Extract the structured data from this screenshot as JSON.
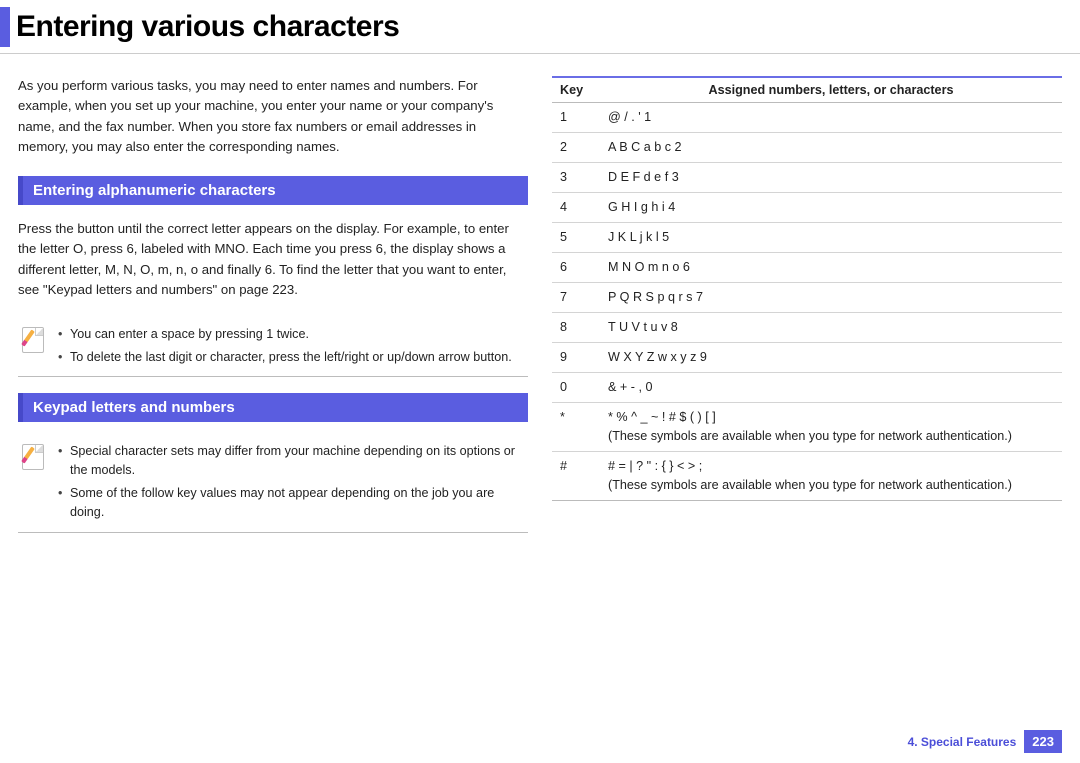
{
  "title": "Entering various characters",
  "intro": "As you perform various tasks, you may need to enter names and numbers. For example, when you set up your machine, you enter your name or your company's name, and the fax number. When you store fax numbers or email addresses in memory, you may also enter the corresponding names.",
  "section1": {
    "heading": "Entering alphanumeric characters",
    "body": "Press the button until the correct letter appears on the display. For example, to enter the letter O, press 6, labeled with MNO. Each time you press 6, the display shows a different letter, M, N, O, m, n, o and finally 6. To find the letter that you want to enter, see \"Keypad letters and numbers\" on page 223.",
    "notes": [
      "You can enter a space by pressing 1 twice.",
      "To delete the last digit or character, press the left/right or up/down arrow button."
    ]
  },
  "section2": {
    "heading": "Keypad letters and numbers",
    "notes": [
      "Special character sets may differ from your machine depending on its options or the models.",
      "Some of the follow key values may not appear depending on the job you are doing."
    ]
  },
  "table": {
    "head_key": "Key",
    "head_val": "Assigned numbers, letters, or characters",
    "rows": [
      {
        "k": "1",
        "v": "@ / . ' 1"
      },
      {
        "k": "2",
        "v": "A B C a b c 2"
      },
      {
        "k": "3",
        "v": "D E F d e f 3"
      },
      {
        "k": "4",
        "v": "G H I g h i 4"
      },
      {
        "k": "5",
        "v": "J K L j k l 5"
      },
      {
        "k": "6",
        "v": "M N O m n o 6"
      },
      {
        "k": "7",
        "v": "P Q R S p q r s 7"
      },
      {
        "k": "8",
        "v": "T U V t u v 8"
      },
      {
        "k": "9",
        "v": "W X Y Z w x y z 9"
      },
      {
        "k": "0",
        "v": "& + - , 0"
      },
      {
        "k": "*",
        "v": "* % ^ _ ~ ! # $ ( ) [ ]",
        "note": "(These symbols are available when you type for network authentication.)"
      },
      {
        "k": "#",
        "v": "# = | ? \" : { } < > ;",
        "note": "(These symbols are available when you type for network authentication.)"
      }
    ]
  },
  "footer": {
    "chapter": "4.  Special Features",
    "page": "223"
  }
}
